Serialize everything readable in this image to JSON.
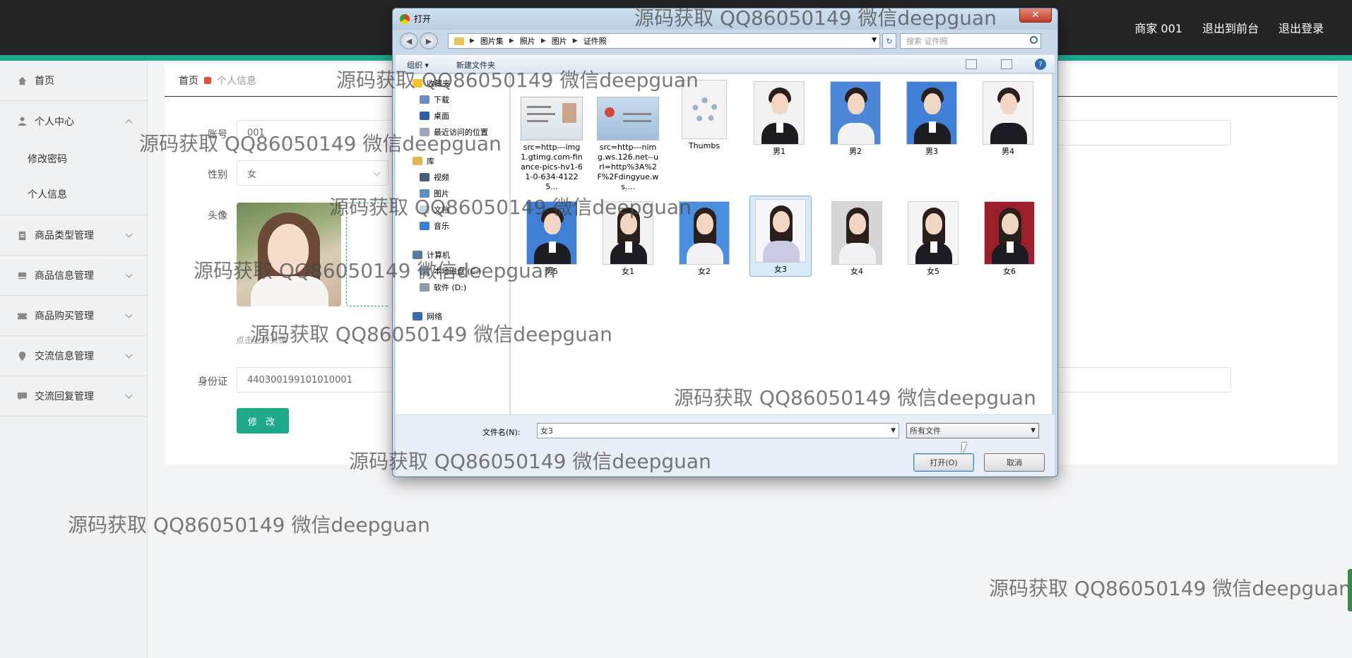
{
  "topbar": {
    "merchant": "商家 001",
    "to_front": "退出到前台",
    "logout": "退出登录"
  },
  "sidebar": {
    "home": "首页",
    "personal_center": "个人中心",
    "change_password": "修改密码",
    "personal_info": "个人信息",
    "menus": [
      "商品类型管理",
      "商品信息管理",
      "商品购买管理",
      "交流信息管理",
      "交流回复管理"
    ]
  },
  "breadcrumb": {
    "home": "首页",
    "current": "个人信息"
  },
  "form": {
    "account_label": "账号",
    "account_value": "001",
    "gender_label": "性别",
    "gender_value": "女",
    "avatar_label": "头像",
    "upload_hint": "点击上传头像",
    "id_label": "身份证",
    "id_value": "440300199101010001",
    "submit": "修 改"
  },
  "dialog": {
    "title": "打开",
    "close": "✕",
    "path": [
      "图片集",
      "照片",
      "图片",
      "证件照"
    ],
    "search_placeholder": "搜索 证件照",
    "organize": "组织 ▾",
    "new_folder": "新建文件夹",
    "help": "?",
    "nav": {
      "favorites": "收藏夹",
      "downloads": "下载",
      "desktop": "桌面",
      "recent": "最近访问的位置",
      "libraries": "库",
      "videos": "视频",
      "pictures": "图片",
      "documents": "文档",
      "music": "音乐",
      "computer": "计算机",
      "drive_c": "本地磁盘 (C:)",
      "drive_d": "软件 (D:)",
      "network": "网络"
    },
    "files_row1": [
      "src=http---img1.gtimg.com-finance-pics-hv1-61-0-634-41225...",
      "src=http---nimg.ws.126.net--url=http%3A%2F%2Fdingyue.ws....",
      "Thumbs",
      "男1",
      "男2",
      "男3",
      "男4"
    ],
    "files_row2": [
      "男5",
      "女1",
      "女2",
      "女3",
      "女4",
      "女5",
      "女6"
    ],
    "selected_file": "女3",
    "filename_label": "文件名(N):",
    "filename_value": "女3",
    "filetype_value": "所有文件",
    "open_button": "打开(O)",
    "cancel_button": "取消"
  },
  "watermark": "源码获取 QQ86050149 微信deepguan",
  "colors": {
    "accent": "#1ea98b",
    "topbar": "#252525",
    "danger": "#e74c3c"
  }
}
